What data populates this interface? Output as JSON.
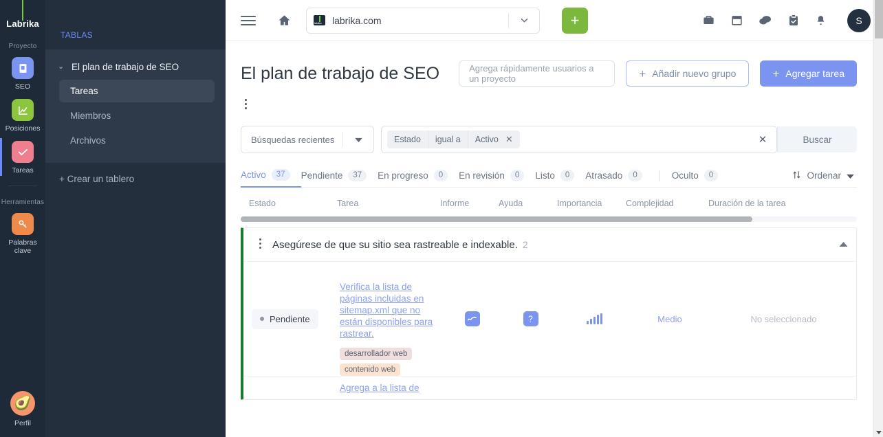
{
  "rail": {
    "brand": "Labrika",
    "project_label": "Proyecto",
    "tools_label": "Herramientas",
    "items": [
      {
        "label": "SEO",
        "icon": "clipboard-seo-icon",
        "color": "#7b94f0"
      },
      {
        "label": "Posiciones",
        "icon": "chart-positions-icon",
        "color": "#8cc63f"
      },
      {
        "label": "Tareas",
        "icon": "check-tasks-icon",
        "color": "#ef7f8e"
      },
      {
        "label": "Palabras clave",
        "icon": "key-keywords-icon",
        "color": "#f08a4b"
      }
    ],
    "profile_label": "Perfil",
    "profile_icon": "avocado-avatar-icon"
  },
  "sidebar": {
    "title": "TABLAS",
    "board": "El plan de trabajo de SEO",
    "items": [
      {
        "label": "Tareas",
        "selected": true
      },
      {
        "label": "Miembros",
        "selected": false
      },
      {
        "label": "Archivos",
        "selected": false
      }
    ],
    "create_board": "+ Crear un tablero"
  },
  "topbar": {
    "menu_icon": "hamburger-menu-icon",
    "home_icon": "home-icon",
    "url": "labrika.com",
    "url_caret_icon": "chevron-down-icon",
    "add_icon": "plus-icon",
    "icons": [
      "briefcase-icon",
      "calendar-icon",
      "chat-icon",
      "clipboard-check-icon",
      "bell-icon"
    ],
    "avatar_initial": "S"
  },
  "page": {
    "title": "El plan de trabajo de SEO",
    "quick_add_placeholder": "Agrega rápidamente usuarios a un proyecto",
    "add_group_label": "Añadir nuevo grupo",
    "add_task_label": "Agregar tarea",
    "plus_glyph": "+",
    "kebab_icon": "more-options-icon"
  },
  "filters": {
    "recent_searches_label": "Búsquedas recientes",
    "chip_field": "Estado",
    "chip_operator": "igual a",
    "chip_value": "Activo",
    "chip_remove_icon": "close-icon",
    "clear_icon": "close-icon",
    "search_button": "Buscar"
  },
  "tabs": [
    {
      "label": "Activo",
      "count": "37",
      "active": true
    },
    {
      "label": "Pendiente",
      "count": "37",
      "active": false
    },
    {
      "label": "En progreso",
      "count": "0",
      "active": false
    },
    {
      "label": "En revisión",
      "count": "0",
      "active": false
    },
    {
      "label": "Listo",
      "count": "0",
      "active": false
    },
    {
      "label": "Atrasado",
      "count": "0",
      "active": false
    }
  ],
  "hidden_tab": {
    "label": "Oculto",
    "count": "0"
  },
  "sort": {
    "label": "Ordenar",
    "icon": "sort-icon",
    "caret": "chevron-down-icon"
  },
  "table": {
    "columns": [
      "Estado",
      "Tarea",
      "Informe",
      "Ayuda",
      "Importancia",
      "Complejidad",
      "Duración de la tarea"
    ],
    "group": {
      "title": "Asegúrese de que su sitio sea rastreable e indexable.",
      "count": "2",
      "collapse_icon": "chevron-up-icon",
      "accent_color": "#1a7a2e"
    },
    "rows": [
      {
        "estado": "Pendiente",
        "tarea": "Verifica la lista de páginas incluidas en sitemap.xml que no están disponibles para rastrear.",
        "tags": [
          "desarrollador web",
          "contenido web"
        ],
        "informe_icon": "report-chart-icon",
        "ayuda_icon": "help-question-icon",
        "importancia_icon": "importance-bars-icon",
        "complejidad": "Medio",
        "duracion": "No seleccionado"
      },
      {
        "tarea": "Agrega a la lista de"
      }
    ]
  }
}
